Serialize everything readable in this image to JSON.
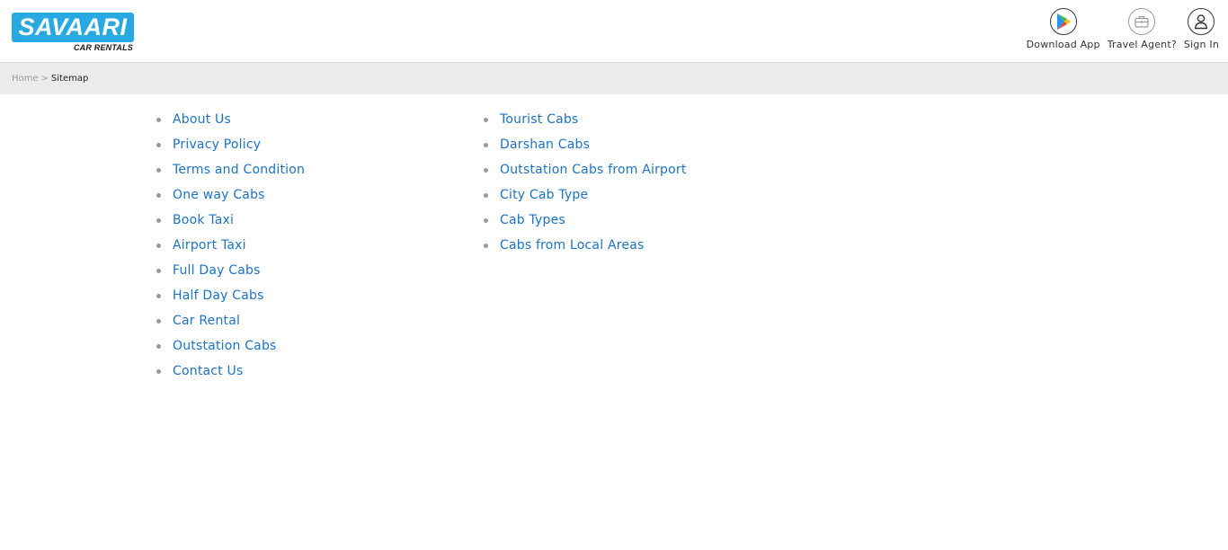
{
  "logo": {
    "brand": "SAVAARI",
    "tagline": "CAR RENTALS"
  },
  "header": {
    "actions": [
      {
        "label": "Download App",
        "icon": "play-store-icon"
      },
      {
        "label": "Travel Agent?",
        "icon": "briefcase-icon"
      },
      {
        "label": "Sign In",
        "icon": "user-icon"
      }
    ]
  },
  "breadcrumb": {
    "home": "Home",
    "separator": ">",
    "current": "Sitemap"
  },
  "sitemap": {
    "column1": [
      "About Us",
      "Privacy Policy",
      "Terms and Condition",
      "One way Cabs",
      "Book Taxi",
      "Airport Taxi",
      "Full Day Cabs",
      "Half Day Cabs",
      "Car Rental",
      "Outstation Cabs",
      "Contact Us"
    ],
    "column2": [
      "Tourist Cabs",
      "Darshan Cabs",
      "Outstation Cabs from Airport",
      "City Cab Type",
      "Cab Types",
      "Cabs from Local Areas"
    ]
  },
  "colors": {
    "brand_blue": "#29a9e1",
    "link": "#1c73c4",
    "breadcrumb_bg": "#ecebe9"
  }
}
